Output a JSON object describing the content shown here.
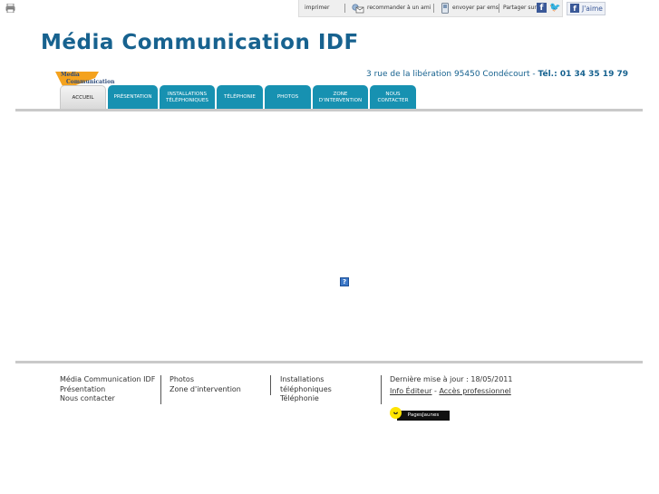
{
  "toolbar": {
    "print": "imprimer",
    "recommend": "recommander à un ami",
    "email": "envoyer par ems",
    "share": "Partager sur",
    "like": "J'aime"
  },
  "site": {
    "title": "Média Communication IDF",
    "logo_line1": "Media",
    "logo_line2": "Communication",
    "address": "3 rue de la libération 95450 Condécourt  - ",
    "phone_label": "Tél.:",
    "phone": " 01 34 35 19 79"
  },
  "nav": {
    "tabs": [
      {
        "label": "ACCUEIL"
      },
      {
        "label": "PRÉSENTATION"
      },
      {
        "label": "INSTALLATIONS TÉLÉPHONIQUES"
      },
      {
        "label": "TÉLÉPHONIE"
      },
      {
        "label": "PHOTOS"
      },
      {
        "label": "ZONE D'INTERVENTION"
      },
      {
        "label": "NOUS CONTACTER"
      }
    ]
  },
  "main": {
    "missing_image_glyph": "?"
  },
  "footer": {
    "col1": [
      "Média Communication IDF",
      "Présentation",
      "Nous contacter"
    ],
    "col2": [
      "Photos",
      "Zone d'intervention"
    ],
    "col3": [
      "Installations",
      "téléphoniques",
      "Téléphonie"
    ],
    "updated": "Dernière mise à jour : 18/05/2011",
    "info_editeur": "Info Éditeur",
    "dash": " - ",
    "acces_pro": "Accès professionnel",
    "pj_label": "PagesJaunes"
  },
  "colors": {
    "brand": "#17628f",
    "tab": "#1791b1"
  }
}
